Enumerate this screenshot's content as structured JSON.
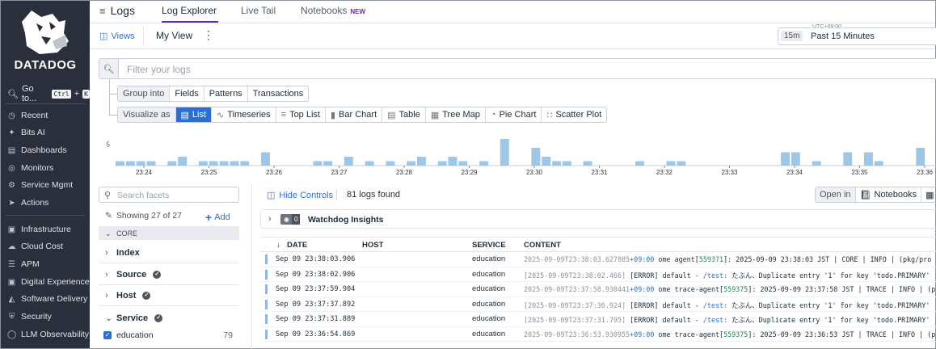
{
  "sidebar": {
    "brand": "DATADOG",
    "goto_label": "Go to...",
    "goto_keys": [
      "Ctrl",
      "+",
      "K"
    ],
    "items": [
      {
        "label": "Recent",
        "icon": "clock-icon"
      },
      {
        "label": "Bits AI",
        "icon": "sparkle-icon"
      },
      {
        "label": "Dashboards",
        "icon": "dashboard-icon"
      },
      {
        "label": "Monitors",
        "icon": "monitor-icon"
      },
      {
        "label": "Service Mgmt",
        "icon": "service-icon"
      },
      {
        "label": "Actions",
        "icon": "bolt-icon"
      },
      {
        "label": "Infrastructure",
        "icon": "infrastructure-icon"
      },
      {
        "label": "Cloud Cost",
        "icon": "cloud-cost-icon"
      },
      {
        "label": "APM",
        "icon": "apm-icon"
      },
      {
        "label": "Digital Experience",
        "icon": "digital-experience-icon"
      },
      {
        "label": "Software Delivery",
        "icon": "software-delivery-icon"
      },
      {
        "label": "Security",
        "icon": "shield-icon"
      },
      {
        "label": "LLM Observability",
        "icon": "llm-icon"
      }
    ]
  },
  "header": {
    "title": "Logs",
    "tabs": [
      {
        "label": "Log Explorer"
      },
      {
        "label": "Live Tail"
      },
      {
        "label": "Notebooks"
      }
    ],
    "new_badge": "NEW"
  },
  "subbar": {
    "views_label": "Views",
    "view_name": "My View",
    "timezone": "UTC+09:00",
    "time_short": "15m",
    "time_range": "Past 15 Minutes"
  },
  "search": {
    "placeholder": "Filter your logs"
  },
  "group_into": {
    "label": "Group into",
    "options": [
      "Fields",
      "Patterns",
      "Transactions"
    ]
  },
  "visualize_as": {
    "label": "Visualize as",
    "options": [
      "List",
      "Timeseries",
      "Top List",
      "Bar Chart",
      "Table",
      "Tree Map",
      "Pie Chart",
      "Scatter Plot"
    ],
    "selected": "List"
  },
  "histogram": {
    "y_tick": "5",
    "x_ticks": [
      "23:24",
      "23:25",
      "23:26",
      "23:27",
      "23:28",
      "23:29",
      "23:30",
      "23:31",
      "23:32",
      "23:33",
      "23:34",
      "23:35",
      "23:36"
    ],
    "counts": [
      1,
      1,
      1,
      1,
      0,
      1,
      2,
      0,
      1,
      1,
      1,
      1,
      1,
      0,
      3,
      0,
      0,
      0,
      0,
      1,
      1,
      0,
      2,
      0,
      1,
      0,
      1,
      0,
      1,
      2,
      0,
      1,
      2,
      1,
      0,
      1,
      0,
      6,
      0,
      0,
      4,
      2,
      1,
      1,
      0,
      1,
      0,
      0,
      0,
      0,
      1,
      0,
      0,
      1,
      1,
      0,
      0,
      0,
      0,
      0,
      0,
      0,
      0,
      0,
      3,
      3,
      0,
      1,
      0,
      0,
      3,
      0,
      3,
      1,
      0,
      0,
      0,
      4,
      0
    ]
  },
  "facets": {
    "search_placeholder": "Search facets",
    "showing": "Showing 27 of 27",
    "add_label": "Add",
    "section": "CORE",
    "groups": [
      "Index",
      "Source",
      "Host",
      "Service"
    ],
    "values": [
      {
        "label": "education",
        "count": "79"
      }
    ]
  },
  "results": {
    "hide_controls": "Hide Controls",
    "count_text": "81 logs found",
    "open_in_label": "Open in",
    "open_in_targets": [
      "Notebooks",
      "S"
    ],
    "watchdog": {
      "count": "0",
      "title": "Watchdog Insights"
    },
    "columns": [
      "DATE",
      "HOST",
      "SERVICE",
      "CONTENT"
    ],
    "rows": [
      {
        "date": "Sep 09 23:38:03.906",
        "service": "education",
        "c1": "2025-09-09T23:38:03.627885",
        "c2": "+09:00",
        "c3": " ome agent[",
        "c4": "559371",
        "c5": "]: 2025-09-09 23:38:03 JST | CORE | INFO | (pkg/pro"
      },
      {
        "date": "Sep 09 23:38:02.906",
        "service": "education",
        "c1": "[2025-09-09T23:38:02.466]",
        "c2": "",
        "c3": " [ERROR] default - ",
        "c4": "/test:",
        "c5": " たぶん、Duplicate entry '1' for key 'todo.PRIMARY'"
      },
      {
        "date": "Sep 09 23:37:59.904",
        "service": "education",
        "c1": "2025-09-09T23:37:58.930441",
        "c2": "+09:00",
        "c3": " ome trace-agent[",
        "c4": "559375",
        "c5": "]: 2025-09-09 23:37:58 JST | TRACE | INFO | (pk"
      },
      {
        "date": "Sep 09 23:37:37.892",
        "service": "education",
        "c1": "[2025-09-09T23:37:36.924]",
        "c2": "",
        "c3": " [ERROR] default - ",
        "c4": "/test:",
        "c5": " たぶん、Duplicate entry '1' for key 'todo.PRIMARY'"
      },
      {
        "date": "Sep 09 23:37:31.889",
        "service": "education",
        "c1": "[2025-09-09T23:37:31.795]",
        "c2": "",
        "c3": " [ERROR] default - ",
        "c4": "/test:",
        "c5": " たぶん、Duplicate entry '1' for key 'todo.PRIMARY'"
      },
      {
        "date": "Sep 09 23:36:54.869",
        "service": "education",
        "c1": "2025-09-09T23:36:53.930955",
        "c2": "+09:00",
        "c3": " ome trace-agent[",
        "c4": "559375",
        "c5": "]: 2025-09-09 23:36:53 JST | TRACE | INFO | (pk"
      }
    ]
  },
  "colors": {
    "accent": "#632ca6",
    "link": "#2b6fd6",
    "sidebar_bg": "#2b2f3b",
    "bar": "#9ec6e6"
  }
}
